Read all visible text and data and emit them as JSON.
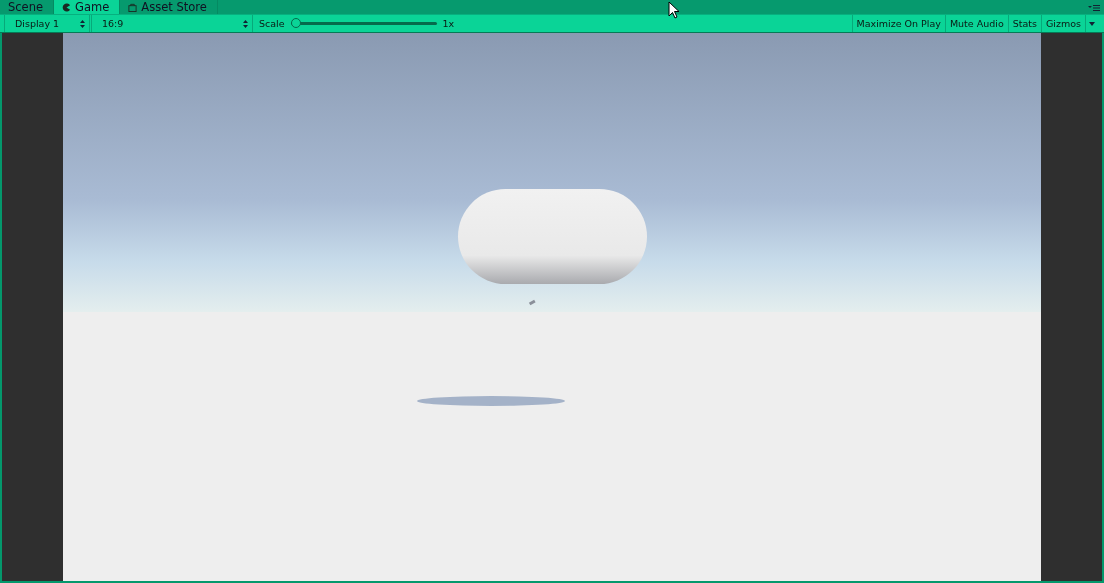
{
  "tabs": [
    {
      "label": "Scene",
      "selected": false
    },
    {
      "label": "Game",
      "selected": true
    },
    {
      "label": "Asset Store",
      "selected": false
    }
  ],
  "toolbar": {
    "display": "Display 1",
    "aspect": "16:9",
    "scale": {
      "label": "Scale",
      "level": 0,
      "reading": "1x"
    },
    "toggles": [
      {
        "label": "Maximize On Play",
        "on": false,
        "dropdown": false
      },
      {
        "label": "Mute Audio",
        "on": false,
        "dropdown": false
      },
      {
        "label": "Stats",
        "on": false,
        "dropdown": false
      },
      {
        "label": "Gizmos",
        "on": false,
        "dropdown": true
      }
    ]
  }
}
